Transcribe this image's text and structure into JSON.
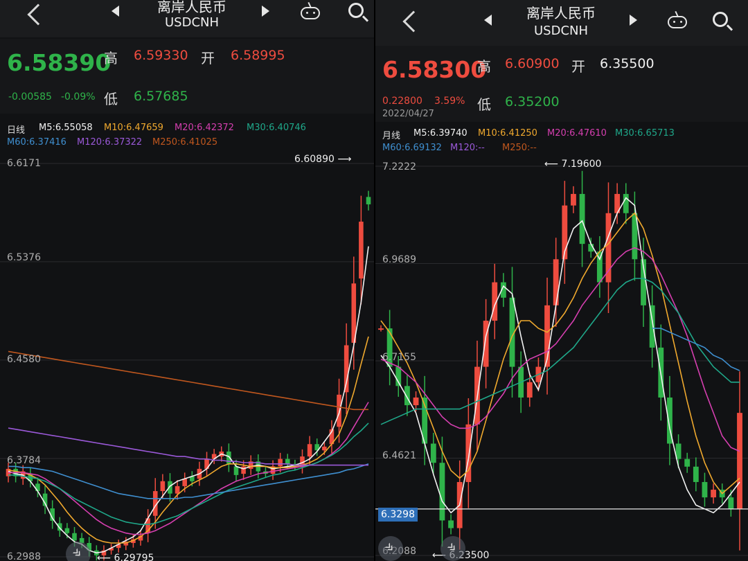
{
  "colors": {
    "up": "#ee4c3f",
    "down": "#2fb34a",
    "ma5": "#f2f2f2",
    "ma10": "#f0a92e",
    "ma20": "#d63fb0",
    "ma30": "#1fa88a",
    "ma60": "#3f8fd0",
    "ma120": "#9b59d9",
    "ma250": "#c0571e"
  },
  "icons": [
    "back-icon",
    "prev-icon",
    "next-icon",
    "robot-icon",
    "search-icon",
    "expand-icon"
  ],
  "left": {
    "title": "离岸人民币",
    "subtitle": "USDCNH",
    "price": "6.58390",
    "change": "-0.00585",
    "change_pct": "-0.09%",
    "high_label": "高",
    "high": "6.59330",
    "open_label": "开",
    "open": "6.58995",
    "low_label": "低",
    "low": "6.57685",
    "period": "日线",
    "ma": {
      "m5": "M5:6.55058",
      "m10": "M10:6.47659",
      "m20": "M20:6.42372",
      "m30": "M30:6.40746",
      "m60": "M60:6.37416",
      "m120": "M120:6.37322",
      "m250": "M250:6.41025"
    },
    "y_labels": [
      "6.6171",
      "6.5376",
      "6.4580",
      "6.3784",
      "6.2988"
    ],
    "max_label": "6.60890",
    "min_label": "6.29795"
  },
  "right": {
    "title": "离岸人民币",
    "subtitle": "USDCNH",
    "price": "6.58300",
    "change": "0.22800",
    "change_pct": "3.59%",
    "date": "2022/04/27",
    "high_label": "高",
    "high": "6.60900",
    "open_label": "开",
    "open": "6.35500",
    "low_label": "低",
    "low": "6.35200",
    "period": "月线",
    "ma": {
      "m5": "M5:6.39740",
      "m10": "M10:6.41250",
      "m20": "M20:6.47610",
      "m30": "M30:6.65713",
      "m60": "M60:6.69132",
      "m120": "M120:--",
      "m250": "M250:--"
    },
    "y_labels": [
      "7.2222",
      "6.9689",
      "6.7155",
      "6.4621",
      "6.2088"
    ],
    "crosshair_label": "6.3298",
    "max_label": "7.19600",
    "min_label": "6.23500"
  },
  "chart_data": [
    {
      "type": "candlestick",
      "title": "日线",
      "ylim": [
        6.2988,
        6.6171
      ],
      "ticks": [
        6.6171,
        6.5376,
        6.458,
        6.3784,
        6.2988
      ],
      "max": 6.6089,
      "min": 6.29795,
      "series": [
        {
          "name": "M5",
          "values": [
            6.368,
            6.366,
            6.365,
            6.36,
            6.352,
            6.342,
            6.33,
            6.322,
            6.316,
            6.311,
            6.309,
            6.304,
            6.302,
            6.303,
            6.306,
            6.309,
            6.312,
            6.315,
            6.32,
            6.33,
            6.34,
            6.348,
            6.356,
            6.36,
            6.362,
            6.364,
            6.366,
            6.37,
            6.378,
            6.382,
            6.38,
            6.372,
            6.37,
            6.372,
            6.373,
            6.372,
            6.37,
            6.371,
            6.372,
            6.373,
            6.375,
            6.378,
            6.384,
            6.392,
            6.4,
            6.415,
            6.44,
            6.47,
            6.505,
            6.55
          ]
        },
        {
          "name": "M10",
          "values": [
            6.369,
            6.368,
            6.367,
            6.365,
            6.362,
            6.357,
            6.35,
            6.343,
            6.335,
            6.328,
            6.322,
            6.317,
            6.313,
            6.311,
            6.31,
            6.31,
            6.31,
            6.312,
            6.315,
            6.32,
            6.327,
            6.335,
            6.342,
            6.349,
            6.354,
            6.358,
            6.361,
            6.364,
            6.368,
            6.372,
            6.374,
            6.374,
            6.373,
            6.372,
            6.372,
            6.372,
            6.371,
            6.371,
            6.371,
            6.372,
            6.373,
            6.375,
            6.378,
            6.383,
            6.39,
            6.398,
            6.413,
            6.432,
            6.455,
            6.477
          ]
        },
        {
          "name": "M20",
          "values": [
            6.367,
            6.367,
            6.367,
            6.366,
            6.365,
            6.362,
            6.358,
            6.354,
            6.349,
            6.344,
            6.339,
            6.334,
            6.329,
            6.325,
            6.322,
            6.32,
            6.318,
            6.317,
            6.317,
            6.318,
            6.32,
            6.323,
            6.326,
            6.33,
            6.334,
            6.338,
            6.342,
            6.346,
            6.35,
            6.354,
            6.357,
            6.36,
            6.362,
            6.364,
            6.366,
            6.367,
            6.368,
            6.369,
            6.37,
            6.371,
            6.372,
            6.373,
            6.375,
            6.378,
            6.382,
            6.387,
            6.394,
            6.404,
            6.414,
            6.424
          ]
        },
        {
          "name": "M30",
          "values": [
            6.365,
            6.365,
            6.364,
            6.363,
            6.362,
            6.36,
            6.357,
            6.354,
            6.35,
            6.346,
            6.343,
            6.34,
            6.337,
            6.334,
            6.331,
            6.329,
            6.327,
            6.326,
            6.325,
            6.325,
            6.326,
            6.328,
            6.33,
            6.332,
            6.335,
            6.338,
            6.341,
            6.344,
            6.347,
            6.35,
            6.353,
            6.355,
            6.357,
            6.359,
            6.361,
            6.363,
            6.365,
            6.366,
            6.368,
            6.369,
            6.371,
            6.373,
            6.375,
            6.378,
            6.381,
            6.385,
            6.39,
            6.396,
            6.401,
            6.407
          ]
        },
        {
          "name": "M60",
          "values": [
            6.372,
            6.372,
            6.371,
            6.371,
            6.37,
            6.369,
            6.368,
            6.366,
            6.364,
            6.362,
            6.36,
            6.358,
            6.356,
            6.354,
            6.352,
            6.35,
            6.349,
            6.348,
            6.347,
            6.346,
            6.346,
            6.346,
            6.346,
            6.346,
            6.347,
            6.347,
            6.348,
            6.349,
            6.35,
            6.351,
            6.352,
            6.353,
            6.354,
            6.355,
            6.356,
            6.357,
            6.358,
            6.359,
            6.36,
            6.361,
            6.362,
            6.363,
            6.364,
            6.365,
            6.366,
            6.367,
            6.369,
            6.37,
            6.372,
            6.374
          ]
        },
        {
          "name": "M120",
          "values": [
            6.403,
            6.402,
            6.401,
            6.4,
            6.399,
            6.398,
            6.397,
            6.396,
            6.395,
            6.394,
            6.393,
            6.392,
            6.391,
            6.39,
            6.389,
            6.388,
            6.387,
            6.386,
            6.385,
            6.384,
            6.383,
            6.382,
            6.381,
            6.38,
            6.38,
            6.379,
            6.378,
            6.378,
            6.377,
            6.377,
            6.376,
            6.376,
            6.375,
            6.375,
            6.375,
            6.374,
            6.374,
            6.374,
            6.374,
            6.373,
            6.373,
            6.373,
            6.373,
            6.373,
            6.373,
            6.373,
            6.373,
            6.373,
            6.373,
            6.373
          ]
        },
        {
          "name": "M250",
          "values": [
            6.465,
            6.464,
            6.463,
            6.462,
            6.461,
            6.46,
            6.459,
            6.458,
            6.457,
            6.456,
            6.455,
            6.454,
            6.453,
            6.452,
            6.451,
            6.45,
            6.449,
            6.448,
            6.447,
            6.446,
            6.445,
            6.444,
            6.443,
            6.442,
            6.441,
            6.44,
            6.439,
            6.438,
            6.437,
            6.436,
            6.435,
            6.434,
            6.433,
            6.432,
            6.431,
            6.43,
            6.429,
            6.428,
            6.427,
            6.426,
            6.425,
            6.424,
            6.423,
            6.422,
            6.421,
            6.42,
            6.419,
            6.418,
            6.418,
            6.418
          ]
        }
      ],
      "candles_close": [
        6.37,
        6.364,
        6.368,
        6.36,
        6.352,
        6.34,
        6.328,
        6.32,
        6.318,
        6.312,
        6.31,
        6.304,
        6.3,
        6.304,
        6.306,
        6.309,
        6.311,
        6.313,
        6.316,
        6.33,
        6.352,
        6.36,
        6.35,
        6.356,
        6.362,
        6.36,
        6.37,
        6.378,
        6.382,
        6.384,
        6.374,
        6.365,
        6.372,
        6.376,
        6.368,
        6.366,
        6.372,
        6.378,
        6.374,
        6.372,
        6.38,
        6.39,
        6.385,
        6.388,
        6.402,
        6.43,
        6.47,
        6.52,
        6.57,
        6.584
      ],
      "candles_open": [
        6.364,
        6.37,
        6.362,
        6.366,
        6.358,
        6.35,
        6.338,
        6.326,
        6.322,
        6.318,
        6.314,
        6.31,
        6.304,
        6.3,
        6.304,
        6.306,
        6.308,
        6.31,
        6.312,
        6.318,
        6.332,
        6.352,
        6.36,
        6.35,
        6.356,
        6.364,
        6.362,
        6.37,
        6.378,
        6.38,
        6.384,
        6.372,
        6.366,
        6.37,
        6.376,
        6.368,
        6.366,
        6.372,
        6.378,
        6.374,
        6.372,
        6.38,
        6.39,
        6.385,
        6.39,
        6.404,
        6.432,
        6.472,
        6.524,
        6.59
      ]
    },
    {
      "type": "candlestick",
      "title": "月线",
      "ylim": [
        6.2088,
        7.2222
      ],
      "ticks": [
        7.2222,
        6.9689,
        6.7155,
        6.4621,
        6.2088
      ],
      "max": 7.196,
      "min": 6.235,
      "crosshair": 6.3298,
      "series": [
        {
          "name": "M5",
          "values": [
            6.73,
            6.7,
            6.66,
            6.62,
            6.58,
            6.5,
            6.42,
            6.35,
            6.32,
            6.34,
            6.46,
            6.62,
            6.78,
            6.86,
            6.91,
            6.89,
            6.78,
            6.68,
            6.64,
            6.72,
            6.86,
            7.0,
            7.06,
            7.08,
            7.02,
            6.98,
            7.04,
            7.1,
            7.14,
            7.12,
            6.96,
            6.82,
            6.68,
            6.54,
            6.44,
            6.38,
            6.34,
            6.33,
            6.32,
            6.34,
            6.37,
            6.4
          ]
        },
        {
          "name": "M10",
          "values": [
            6.82,
            6.79,
            6.75,
            6.71,
            6.66,
            6.6,
            6.54,
            6.48,
            6.43,
            6.41,
            6.43,
            6.48,
            6.56,
            6.64,
            6.72,
            6.78,
            6.82,
            6.82,
            6.8,
            6.79,
            6.81,
            6.84,
            6.88,
            6.93,
            6.97,
            7.0,
            7.02,
            7.05,
            7.08,
            7.1,
            7.06,
            6.99,
            6.91,
            6.81,
            6.71,
            6.61,
            6.52,
            6.45,
            6.4,
            6.37,
            6.39,
            6.41
          ]
        },
        {
          "name": "M20",
          "values": [
            6.72,
            6.71,
            6.7,
            6.68,
            6.66,
            6.63,
            6.6,
            6.57,
            6.55,
            6.54,
            6.54,
            6.55,
            6.57,
            6.6,
            6.63,
            6.67,
            6.7,
            6.72,
            6.73,
            6.74,
            6.76,
            6.79,
            6.82,
            6.86,
            6.89,
            6.92,
            6.95,
            6.98,
            7.0,
            7.01,
            7.0,
            6.98,
            6.94,
            6.89,
            6.84,
            6.78,
            6.71,
            6.64,
            6.58,
            6.52,
            6.49,
            6.48
          ]
        },
        {
          "name": "M30",
          "values": [
            6.55,
            6.56,
            6.57,
            6.58,
            6.59,
            6.59,
            6.59,
            6.59,
            6.59,
            6.59,
            6.6,
            6.61,
            6.62,
            6.63,
            6.64,
            6.65,
            6.66,
            6.67,
            6.68,
            6.69,
            6.71,
            6.73,
            6.75,
            6.78,
            6.81,
            6.84,
            6.87,
            6.9,
            6.92,
            6.93,
            6.93,
            6.92,
            6.9,
            6.87,
            6.84,
            6.8,
            6.76,
            6.73,
            6.7,
            6.68,
            6.66,
            6.66
          ]
        },
        {
          "name": "M60",
          "values": [
            null,
            null,
            null,
            null,
            null,
            null,
            null,
            null,
            null,
            null,
            null,
            null,
            null,
            null,
            null,
            null,
            null,
            null,
            null,
            null,
            null,
            null,
            null,
            null,
            null,
            null,
            null,
            null,
            null,
            null,
            null,
            6.8,
            6.8,
            6.79,
            6.78,
            6.77,
            6.76,
            6.75,
            6.73,
            6.72,
            6.7,
            6.69
          ]
        }
      ],
      "candles_close": [
        6.8,
        6.7,
        6.65,
        6.6,
        6.62,
        6.5,
        6.45,
        6.3,
        6.28,
        6.4,
        6.55,
        6.7,
        6.82,
        6.92,
        6.88,
        6.7,
        6.62,
        6.66,
        6.7,
        6.86,
        6.98,
        7.12,
        7.15,
        7.02,
        7.0,
        6.92,
        7.1,
        7.15,
        7.1,
        6.98,
        6.86,
        6.75,
        6.62,
        6.5,
        6.46,
        6.44,
        6.4,
        6.36,
        6.38,
        6.36,
        6.33,
        6.58
      ]
    }
  ]
}
